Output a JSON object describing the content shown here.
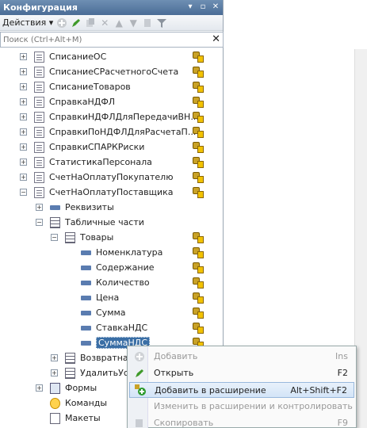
{
  "window": {
    "title": "Конфигурация"
  },
  "toolbar": {
    "actions_label": "Действия ▾"
  },
  "search": {
    "placeholder": "Поиск (Ctrl+Alt+M)"
  },
  "tree": [
    {
      "label": "СписаниеОС",
      "expander": "+",
      "icon": "document-icon",
      "locked": true
    },
    {
      "label": "СписаниеСРасчетногоСчета",
      "expander": "+",
      "icon": "document-icon",
      "locked": true
    },
    {
      "label": "СписаниеТоваров",
      "expander": "+",
      "icon": "document-icon",
      "locked": true
    },
    {
      "label": "СправкаНДФЛ",
      "expander": "+",
      "icon": "document-icon",
      "locked": true
    },
    {
      "label": "СправкиНДФЛДляПередачиВН...",
      "expander": "+",
      "icon": "document-icon",
      "locked": true
    },
    {
      "label": "СправкиПоНДФЛДляРасчетаП...",
      "expander": "+",
      "icon": "document-icon",
      "locked": true
    },
    {
      "label": "СправкиСПАРКРиски",
      "expander": "+",
      "icon": "document-icon",
      "locked": true
    },
    {
      "label": "СтатистикаПерсонала",
      "expander": "+",
      "icon": "document-icon",
      "locked": true
    },
    {
      "label": "СчетНаОплатуПокупателю",
      "expander": "+",
      "icon": "document-icon",
      "locked": true
    },
    {
      "label": "СчетНаОплатуПоставщика",
      "expander": "−",
      "icon": "document-icon",
      "locked": true
    },
    {
      "label": "Реквизиты",
      "expander": "+",
      "icon": "attribute-icon",
      "locked": false
    },
    {
      "label": "Табличные части",
      "expander": "−",
      "icon": "table-icon",
      "locked": false
    },
    {
      "label": "Товары",
      "expander": "−",
      "icon": "table-icon",
      "locked": true
    },
    {
      "label": "Номенклатура",
      "expander": "",
      "icon": "attribute-icon",
      "locked": true
    },
    {
      "label": "Содержание",
      "expander": "",
      "icon": "attribute-icon",
      "locked": true
    },
    {
      "label": "Количество",
      "expander": "",
      "icon": "attribute-icon",
      "locked": true
    },
    {
      "label": "Цена",
      "expander": "",
      "icon": "attribute-icon",
      "locked": true
    },
    {
      "label": "Сумма",
      "expander": "",
      "icon": "attribute-icon",
      "locked": true
    },
    {
      "label": "СтавкаНДС",
      "expander": "",
      "icon": "attribute-icon",
      "locked": true
    },
    {
      "label": "СуммаНДС",
      "expander": "",
      "icon": "attribute-icon",
      "locked": true,
      "selected": true
    },
    {
      "label": "Возвратная",
      "expander": "+",
      "icon": "table-icon",
      "locked": false
    },
    {
      "label": "УдалитьУсл",
      "expander": "+",
      "icon": "table-icon",
      "locked": false
    },
    {
      "label": "Формы",
      "expander": "+",
      "icon": "form-icon",
      "locked": false
    },
    {
      "label": "Команды",
      "expander": "",
      "icon": "command-icon",
      "locked": false
    },
    {
      "label": "Макеты",
      "expander": "",
      "icon": "layout-icon",
      "locked": false
    }
  ],
  "context_menu": [
    {
      "label": "Добавить",
      "shortcut": "Ins",
      "icon": "add-icon",
      "disabled": true
    },
    {
      "label": "Открыть",
      "shortcut": "F2",
      "icon": "pencil-icon",
      "disabled": false
    },
    {
      "label": "Добавить в расширение",
      "shortcut": "Alt+Shift+F2",
      "icon": "add-to-extension-icon",
      "disabled": false,
      "highlighted": true
    },
    {
      "label": "Изменить в расширении и контролировать",
      "shortcut": "",
      "icon": "",
      "disabled": true
    },
    {
      "label": "Скопировать",
      "shortcut": "F9",
      "icon": "copy-icon",
      "disabled": true
    }
  ]
}
